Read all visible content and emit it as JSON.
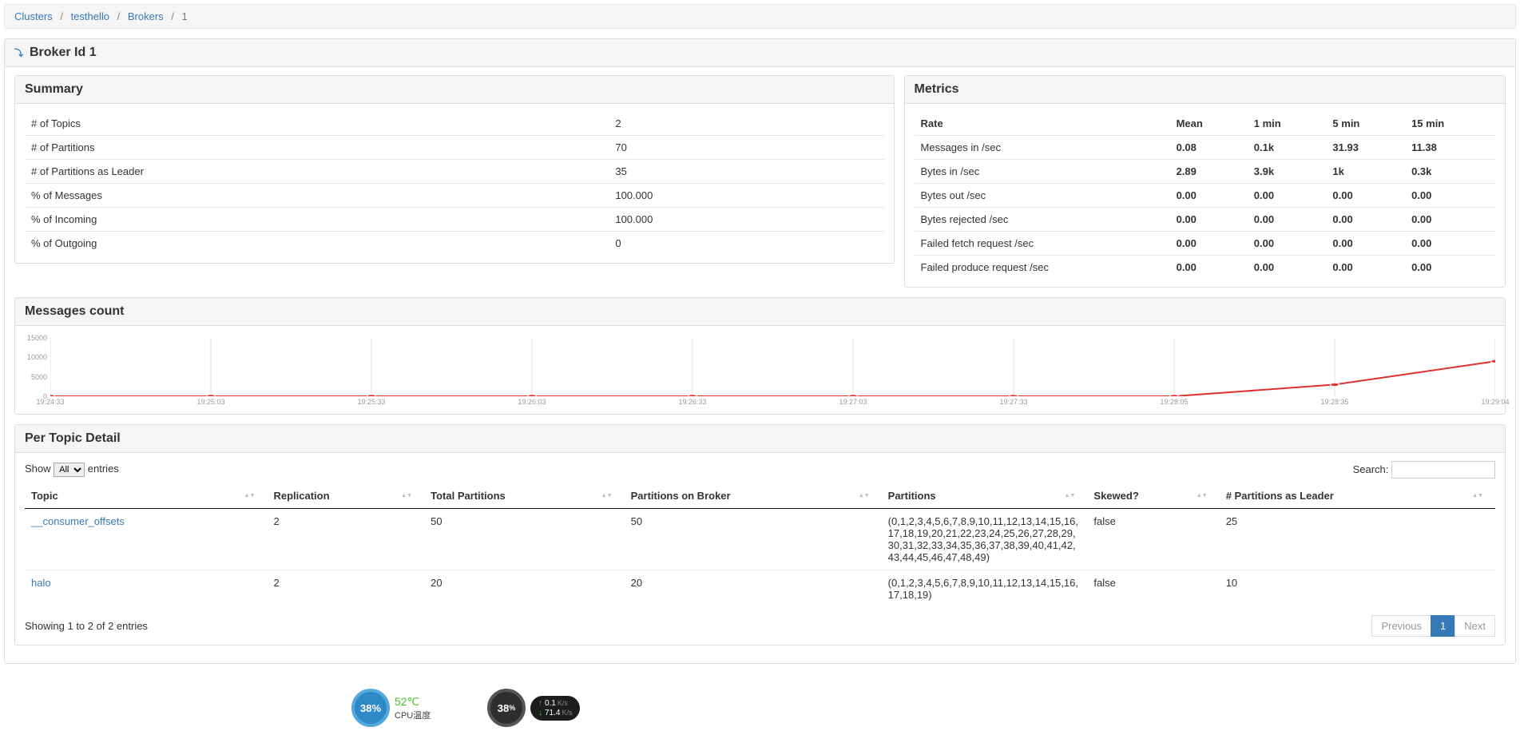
{
  "breadcrumb": {
    "items": [
      {
        "label": "Clusters",
        "link": true
      },
      {
        "label": "testhello",
        "link": true
      },
      {
        "label": "Brokers",
        "link": true
      },
      {
        "label": "1",
        "link": false
      }
    ]
  },
  "page_title": "Broker Id 1",
  "summary": {
    "heading": "Summary",
    "rows": [
      {
        "label": "# of Topics",
        "value": "2"
      },
      {
        "label": "# of Partitions",
        "value": "70"
      },
      {
        "label": "# of Partitions as Leader",
        "value": "35"
      },
      {
        "label": "% of Messages",
        "value": "100.000"
      },
      {
        "label": "% of Incoming",
        "value": "100.000"
      },
      {
        "label": "% of Outgoing",
        "value": "0"
      }
    ]
  },
  "metrics": {
    "heading": "Metrics",
    "headers": [
      "Rate",
      "Mean",
      "1 min",
      "5 min",
      "15 min"
    ],
    "rows": [
      {
        "label": "Messages in /sec",
        "cells": [
          "0.08",
          "0.1k",
          "31.93",
          "11.38"
        ]
      },
      {
        "label": "Bytes in /sec",
        "cells": [
          "2.89",
          "3.9k",
          "1k",
          "0.3k"
        ]
      },
      {
        "label": "Bytes out /sec",
        "cells": [
          "0.00",
          "0.00",
          "0.00",
          "0.00"
        ]
      },
      {
        "label": "Bytes rejected /sec",
        "cells": [
          "0.00",
          "0.00",
          "0.00",
          "0.00"
        ]
      },
      {
        "label": "Failed fetch request /sec",
        "cells": [
          "0.00",
          "0.00",
          "0.00",
          "0.00"
        ]
      },
      {
        "label": "Failed produce request /sec",
        "cells": [
          "0.00",
          "0.00",
          "0.00",
          "0.00"
        ]
      }
    ]
  },
  "chart": {
    "heading": "Messages count"
  },
  "chart_data": {
    "type": "line",
    "title": "Messages count",
    "xlabel": "",
    "ylabel": "",
    "ylim": [
      0,
      15000
    ],
    "yticks": [
      0,
      5000,
      10000,
      15000
    ],
    "x": [
      "19:24:33",
      "19:25:03",
      "19:25:33",
      "19:26:03",
      "19:26:33",
      "19:27:03",
      "19:27:33",
      "19:28:05",
      "19:28:35",
      "19:29:04"
    ],
    "values": [
      0,
      0,
      0,
      0,
      0,
      0,
      0,
      0,
      3000,
      9000
    ]
  },
  "topics": {
    "heading": "Per Topic Detail",
    "show_label": "Show",
    "entries_label": "entries",
    "length_option": "All",
    "search_label": "Search:",
    "columns": [
      "Topic",
      "Replication",
      "Total Partitions",
      "Partitions on Broker",
      "Partitions",
      "Skewed?",
      "# Partitions as Leader"
    ],
    "rows": [
      {
        "topic": "__consumer_offsets",
        "replication": "2",
        "total": "50",
        "onbroker": "50",
        "partitions": "(0,1,2,3,4,5,6,7,8,9,10,11,12,13,14,15,16,17,18,19,20,21,22,23,24,25,26,27,28,29,30,31,32,33,34,35,36,37,38,39,40,41,42,43,44,45,46,47,48,49)",
        "skewed": "false",
        "leader": "25"
      },
      {
        "topic": "halo",
        "replication": "2",
        "total": "20",
        "onbroker": "20",
        "partitions": "(0,1,2,3,4,5,6,7,8,9,10,11,12,13,14,15,16,17,18,19)",
        "skewed": "false",
        "leader": "10"
      }
    ],
    "info": "Showing 1 to 2 of 2 entries",
    "pager": {
      "prev": "Previous",
      "page": "1",
      "next": "Next"
    }
  },
  "widgets": {
    "cpu": {
      "pct": "38%",
      "temp": "52℃",
      "label": "CPU温度"
    },
    "net": {
      "pct": "38",
      "up": "0.1",
      "down": "71.4",
      "unit": "K/s"
    }
  }
}
